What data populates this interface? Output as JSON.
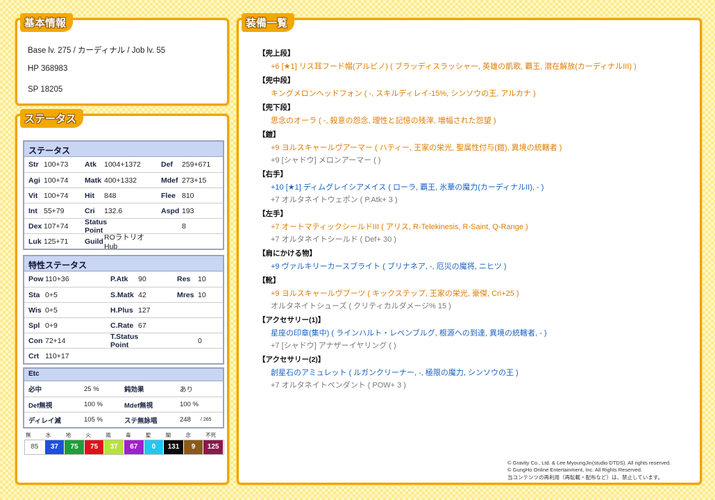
{
  "basic": {
    "title": "基本情報",
    "line1": "Base lv. 275 / カーディナル / Job lv. 55",
    "hp": "HP 368983",
    "sp": "SP 18205"
  },
  "status_panel": {
    "title": "ステータス"
  },
  "status": {
    "header": "ステータス",
    "rows": [
      [
        [
          "Str",
          "100+73"
        ],
        [
          "Atk",
          "1004+1372"
        ],
        [
          "Def",
          "259+671"
        ]
      ],
      [
        [
          "Agi",
          "100+74"
        ],
        [
          "Matk",
          "400+1332"
        ],
        [
          "Mdef",
          "273+15"
        ]
      ],
      [
        [
          "Vit",
          "100+74"
        ],
        [
          "Hit",
          "848"
        ],
        [
          "Flee",
          "810"
        ]
      ],
      [
        [
          "Int",
          "55+79"
        ],
        [
          "Cri",
          "132.6"
        ],
        [
          "Aspd",
          "193"
        ]
      ],
      [
        [
          "Dex",
          "107+74"
        ],
        [
          "Status Point",
          ""
        ],
        [
          "",
          "8"
        ]
      ],
      [
        [
          "Luk",
          "125+71"
        ],
        [
          "Guild",
          "ROラトリオHub"
        ],
        [
          "",
          ""
        ]
      ]
    ]
  },
  "trait": {
    "header": "特性ステータス",
    "rows": [
      [
        [
          "Pow",
          "110+36"
        ],
        [
          "P.Atk",
          "90"
        ],
        [
          "Res",
          "10"
        ]
      ],
      [
        [
          "Sta",
          "0+5"
        ],
        [
          "S.Matk",
          "42"
        ],
        [
          "Mres",
          "10"
        ]
      ],
      [
        [
          "Wis",
          "0+5"
        ],
        [
          "H.Plus",
          "127"
        ],
        [
          "",
          ""
        ]
      ],
      [
        [
          "Spl",
          "0+9"
        ],
        [
          "C.Rate",
          "67"
        ],
        [
          "",
          ""
        ]
      ],
      [
        [
          "Con",
          "72+14"
        ],
        [
          "T.Status Point",
          ""
        ],
        [
          "",
          "0"
        ]
      ],
      [
        [
          "Crt",
          "110+17"
        ],
        [
          "",
          ""
        ],
        [
          "",
          ""
        ]
      ]
    ]
  },
  "etc": {
    "header": "Etc",
    "rows": [
      [
        [
          "必中",
          "25 %"
        ],
        [
          "鈍効果",
          "あり"
        ]
      ],
      [
        [
          "Def無視",
          "100 %"
        ],
        [
          "Mdef無視",
          "100 %"
        ]
      ],
      [
        [
          "ディレイ減",
          "105 %"
        ],
        [
          "ステ無詠唱",
          "248"
        ]
      ]
    ],
    "cast_max": "/ 265"
  },
  "elements": [
    {
      "label": "無",
      "value": "85",
      "color": "#ffffff",
      "text": "#777"
    },
    {
      "label": "水",
      "value": "37",
      "color": "#1e4fe0",
      "text": "#fff"
    },
    {
      "label": "地",
      "value": "75",
      "color": "#1e9e3a",
      "text": "#fff"
    },
    {
      "label": "火",
      "value": "75",
      "color": "#e0101c",
      "text": "#fff"
    },
    {
      "label": "風",
      "value": "37",
      "color": "#b7e23a",
      "text": "#fff"
    },
    {
      "label": "毒",
      "value": "67",
      "color": "#a020d0",
      "text": "#fff"
    },
    {
      "label": "聖",
      "value": "0",
      "color": "#22c8f0",
      "text": "#fff"
    },
    {
      "label": "闇",
      "value": "131",
      "color": "#0a0a0a",
      "text": "#fff"
    },
    {
      "label": "念",
      "value": "9",
      "color": "#8a5a1a",
      "text": "#fff"
    },
    {
      "label": "不死",
      "value": "125",
      "color": "#8a1a4a",
      "text": "#fff"
    }
  ],
  "equip": {
    "title": "装備一覧",
    "groups": [
      {
        "h": "【兜上段】",
        "items": [
          {
            "t": "+6 [★1] リス耳フード帽(アルビノ) ( ブラッディスラッシャー, 英雄の凱歌, 覇王, 潜在解放(カーディナルIII) )",
            "c": "orange"
          }
        ]
      },
      {
        "h": "【兜中段】",
        "items": [
          {
            "t": "キングメロンヘッドフォン ( -, スキルディレイ-15%, シンソウの王, アルカナ )",
            "c": "orange"
          }
        ]
      },
      {
        "h": "【兜下段】",
        "items": [
          {
            "t": "思念のオーラ ( -, 殺意の怨念, 理性と記憶の残滓, 増幅された怨望 )",
            "c": "orange"
          }
        ]
      },
      {
        "h": "【鎧】",
        "items": [
          {
            "t": "+9 ヨルスキャールヴアーマー ( ハティー, 王家の栄光, 聖属性付与(鎧), 異境の統轄者 )",
            "c": "orange"
          },
          {
            "t": "+9 [シャドウ] メロンアーマー ( )",
            "c": "gray"
          }
        ]
      },
      {
        "h": "【右手】",
        "items": [
          {
            "t": "+10 [★1] ディムグレイシアメイス ( ローラ, 覇王, 氷華の魔力(カーディナルII), - )",
            "c": "blue"
          },
          {
            "t": "+7 オルタネイトウェポン ( P.Atk+ 3 )",
            "c": "gray"
          }
        ]
      },
      {
        "h": "【左手】",
        "items": [
          {
            "t": "+7 オートマティックシールドIII ( アリス, R-Telekinesis, R-Saint, Q-Range )",
            "c": "orange"
          },
          {
            "t": "+7 オルタネイトシールド ( Def+ 30 )",
            "c": "gray"
          }
        ]
      },
      {
        "h": "【肩にかける物】",
        "items": [
          {
            "t": "+9 ヴァルキリーカースブライト ( ブリナネア, -, 厄災の魔将, ニヒツ )",
            "c": "blue"
          }
        ]
      },
      {
        "h": "【靴】",
        "items": [
          {
            "t": "+9 ヨルスキャールヴブーツ ( キックステップ, 王家の栄光, 豪傑, Cri+25 )",
            "c": "orange"
          },
          {
            "t": "オルタネイトシューズ ( クリティカルダメージ% 15 )",
            "c": "gray"
          }
        ]
      },
      {
        "h": "【アクセサリー(1)】",
        "items": [
          {
            "t": "星座の印章(集中) ( ラインハルト・レベンブルグ, 根源への到達, 異境の統轄者, - )",
            "c": "blue"
          },
          {
            "t": "+7 [シャドウ] アナザーイヤリング ( )",
            "c": "gray"
          }
        ]
      },
      {
        "h": "【アクセサリー(2)】",
        "items": [
          {
            "t": "創星石のアミュレット ( ルガンクリーナー, -, 極限の魔力, シンソウの王 )",
            "c": "blue"
          },
          {
            "t": "+7 オルタネイトペンダント ( POW+ 3 )",
            "c": "gray"
          }
        ]
      }
    ]
  },
  "copyright": [
    "© Gravity Co., Ltd. & Lee MyoungJin(studio DTDS). All rights reserved.",
    "© GungHo Online Entertainment, Inc. All Rights Reserved.",
    "当コンテンツの再利用（再転載・配布など）は、禁止しています。"
  ]
}
